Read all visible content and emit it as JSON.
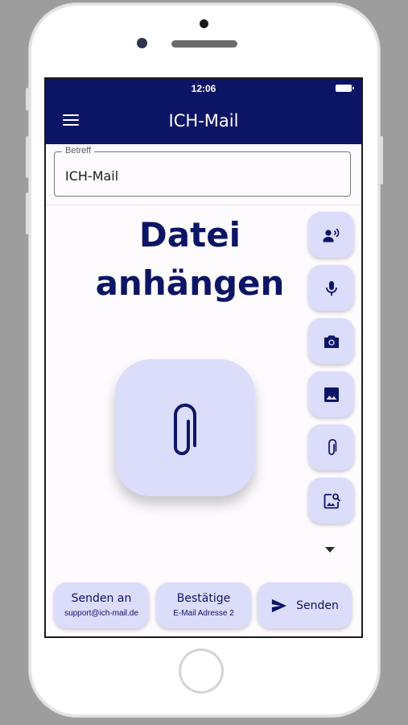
{
  "status_bar": {
    "time": "12:06"
  },
  "app_bar": {
    "title": "ICH-Mail"
  },
  "subject": {
    "label": "Betreff",
    "value": "ICH-Mail"
  },
  "headline": "Datei anhängen",
  "side_actions": [
    {
      "name": "speak-button",
      "icon": "record-voice-over-icon"
    },
    {
      "name": "mic-button",
      "icon": "mic-icon"
    },
    {
      "name": "camera-button",
      "icon": "camera-icon"
    },
    {
      "name": "gallery-button",
      "icon": "image-icon"
    },
    {
      "name": "attach-button",
      "icon": "paperclip-icon"
    },
    {
      "name": "image-search-button",
      "icon": "image-search-icon"
    }
  ],
  "bottom_buttons": {
    "send_to": {
      "title": "Senden an",
      "subtitle": "support@ich-mail.de"
    },
    "confirm": {
      "title": "Bestätige",
      "subtitle": "E-Mail Adresse 2"
    },
    "send": {
      "label": "Senden"
    }
  },
  "colors": {
    "primary": "#0c1565",
    "button_bg": "#dcdcfb",
    "screen_bg": "#fefbff"
  }
}
